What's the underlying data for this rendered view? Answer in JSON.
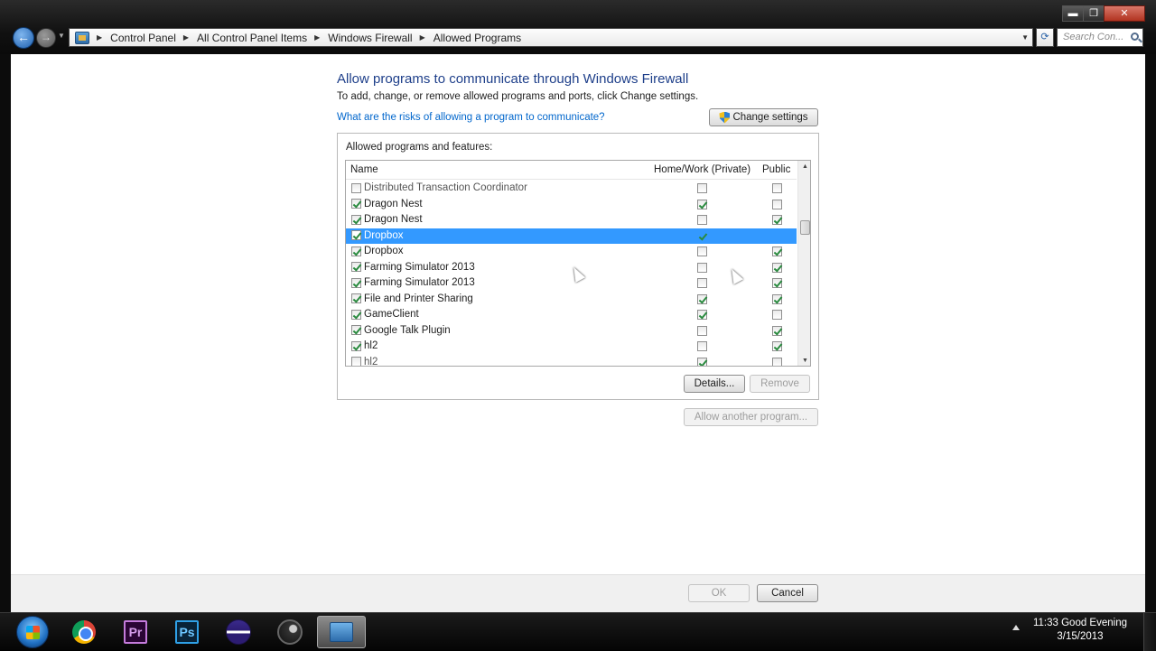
{
  "window": {
    "controls": {
      "minimize": "▬",
      "maximize": "❐",
      "close": "✕"
    }
  },
  "navigation": {
    "back_glyph": "←",
    "forward_glyph": "→",
    "breadcrumb": [
      "Control Panel",
      "All Control Panel Items",
      "Windows Firewall",
      "Allowed Programs"
    ],
    "search_placeholder": "Search Con..."
  },
  "main": {
    "heading": "Allow programs to communicate through Windows Firewall",
    "subtext": "To add, change, or remove allowed programs and ports, click Change settings.",
    "risk_link": "What are the risks of allowing a program to communicate?",
    "change_settings_label": "Change settings",
    "group_label": "Allowed programs and features:",
    "columns": {
      "name": "Name",
      "private": "Home/Work (Private)",
      "public": "Public"
    },
    "rows": [
      {
        "name": "Distributed Transaction Coordinator",
        "enabled": false,
        "private": false,
        "public": false
      },
      {
        "name": "Dragon Nest",
        "enabled": true,
        "private": true,
        "public": false
      },
      {
        "name": "Dragon Nest",
        "enabled": true,
        "private": false,
        "public": true
      },
      {
        "name": "Dropbox",
        "enabled": true,
        "private": true,
        "public": false,
        "selected": true
      },
      {
        "name": "Dropbox",
        "enabled": true,
        "private": false,
        "public": true
      },
      {
        "name": "Farming Simulator 2013",
        "enabled": true,
        "private": false,
        "public": true
      },
      {
        "name": "Farming Simulator 2013",
        "enabled": true,
        "private": false,
        "public": true
      },
      {
        "name": "File and Printer Sharing",
        "enabled": true,
        "private": true,
        "public": true
      },
      {
        "name": "GameClient",
        "enabled": true,
        "private": true,
        "public": false
      },
      {
        "name": "Google Talk Plugin",
        "enabled": true,
        "private": false,
        "public": true
      },
      {
        "name": "hl2",
        "enabled": true,
        "private": false,
        "public": true
      },
      {
        "name": "hl2",
        "enabled": false,
        "private": true,
        "public": false
      }
    ],
    "details_label": "Details...",
    "remove_label": "Remove",
    "allow_another_label": "Allow another program..."
  },
  "footer": {
    "ok_label": "OK",
    "cancel_label": "Cancel"
  },
  "taskbar": {
    "apps": [
      "start-orb",
      "google-chrome",
      "adobe-premiere",
      "adobe-photoshop",
      "eclipse",
      "steam",
      "control-panel"
    ],
    "premiere_text": "Pr",
    "photoshop_text": "Ps",
    "clock_line1": "11:33 Good Evening",
    "clock_line2": "3/15/2013"
  },
  "colors": {
    "selection": "#3399ff",
    "heading": "#1e3f8a",
    "link": "#0066cc"
  }
}
